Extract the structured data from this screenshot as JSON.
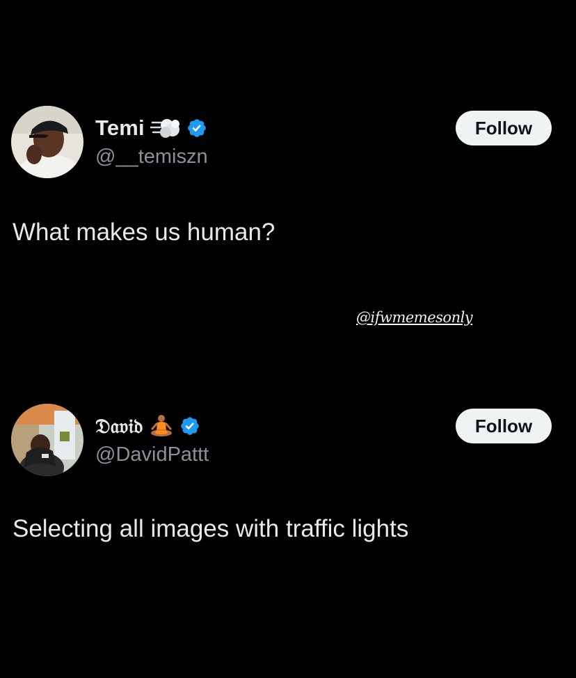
{
  "posts": [
    {
      "display_name": "Temi",
      "emoji": "dashing-away-icon",
      "verified": true,
      "handle": "@__temiszn",
      "follow_label": "Follow",
      "text": "What makes us human?"
    },
    {
      "display_name": "𝔇𝔞𝔳𝔦𝔡",
      "emoji": "person-in-lotus-position-icon",
      "verified": true,
      "handle": "@DavidPattt",
      "follow_label": "Follow",
      "text": "Selecting all images with traffic lights"
    }
  ],
  "watermark": "@ifwmemesonly",
  "colors": {
    "background": "#000000",
    "text_primary": "#e7e9ea",
    "text_secondary": "#8a9199",
    "verified_blue": "#1d9bf0",
    "follow_bg": "#eff3f4",
    "follow_text": "#0f1419"
  }
}
